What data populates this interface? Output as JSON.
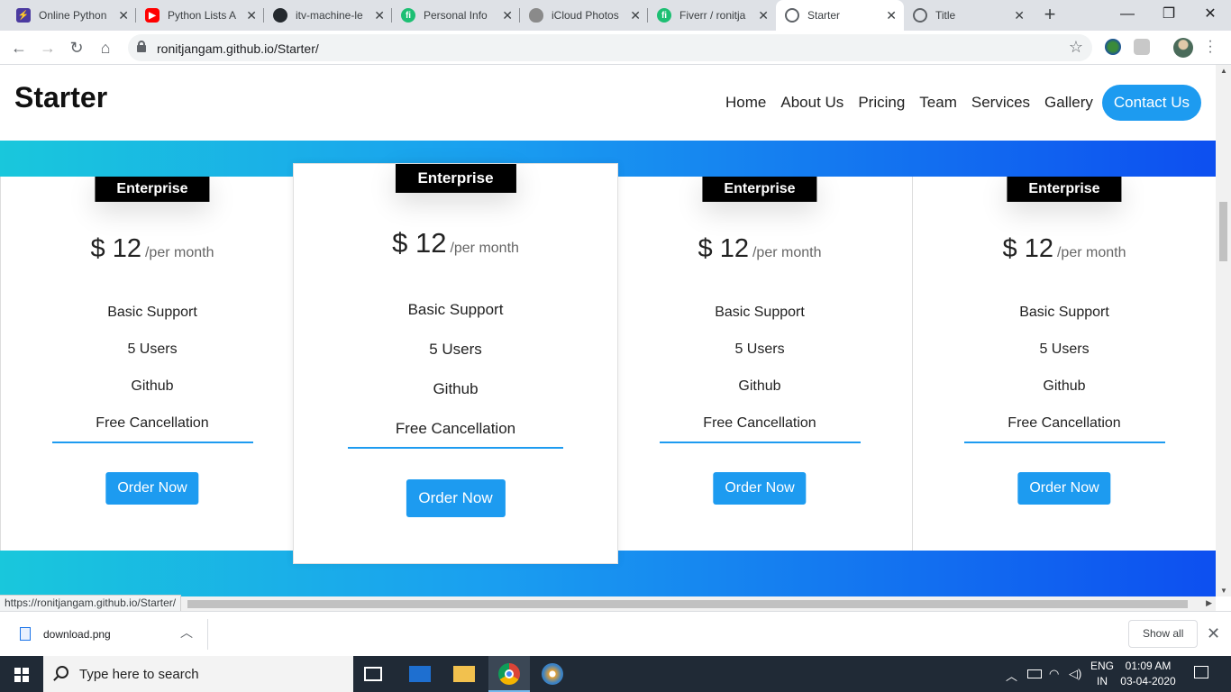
{
  "browser": {
    "tabs": [
      {
        "title": "Online Python",
        "favicon": "bolt-icon",
        "color": "#4b3aa0"
      },
      {
        "title": "Python Lists A",
        "favicon": "youtube-icon",
        "color": "#ff0000"
      },
      {
        "title": "itv-machine-le",
        "favicon": "github-icon",
        "color": "#24292e"
      },
      {
        "title": "Personal Info",
        "favicon": "fiverr-icon",
        "color": "#1dbf73"
      },
      {
        "title": "iCloud Photos",
        "favicon": "apple-icon",
        "color": "#555555"
      },
      {
        "title": "Fiverr / ronitja",
        "favicon": "fiverr-icon",
        "color": "#1dbf73"
      },
      {
        "title": "Starter",
        "favicon": "globe-icon",
        "color": "#5f6368"
      },
      {
        "title": "Title",
        "favicon": "globe-icon",
        "color": "#5f6368"
      }
    ],
    "active_tab": 6,
    "url": "ronitjangam.github.io/Starter/",
    "status_url": "https://ronitjangam.github.io/Starter/"
  },
  "site": {
    "brand": "Starter",
    "nav": [
      "Home",
      "About Us",
      "Pricing",
      "Team",
      "Services",
      "Gallery"
    ],
    "contact": "Contact Us"
  },
  "pricing": {
    "cards": [
      {
        "badge": "Enterprise",
        "currency": "$",
        "amount": "12",
        "period": "/per month",
        "features": [
          "Basic Support",
          "5 Users",
          "Github",
          "Free Cancellation"
        ],
        "button": "Order Now"
      },
      {
        "badge": "Enterprise",
        "currency": "$",
        "amount": "12",
        "period": "/per month",
        "features": [
          "Basic Support",
          "5 Users",
          "Github",
          "Free Cancellation"
        ],
        "button": "Order Now"
      },
      {
        "badge": "Enterprise",
        "currency": "$",
        "amount": "12",
        "period": "/per month",
        "features": [
          "Basic Support",
          "5 Users",
          "Github",
          "Free Cancellation"
        ],
        "button": "Order Now"
      },
      {
        "badge": "Enterprise",
        "currency": "$",
        "amount": "12",
        "period": "/per month",
        "features": [
          "Basic Support",
          "5 Users",
          "Github",
          "Free Cancellation"
        ],
        "button": "Order Now"
      }
    ]
  },
  "downloads": {
    "file": "download.png",
    "show_all": "Show all"
  },
  "taskbar": {
    "search_placeholder": "Type here to search",
    "lang_top": "ENG",
    "lang_bottom": "IN",
    "time": "01:09 AM",
    "date": "03-04-2020"
  },
  "colors": {
    "accent": "#1d9bf0",
    "gradient_start": "#19c7dc",
    "gradient_end": "#0d4ff0"
  }
}
